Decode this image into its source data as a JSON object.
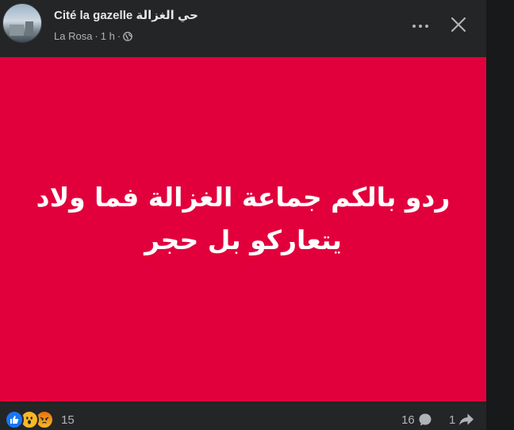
{
  "post": {
    "group_name": "Cité la gazelle حي الغزالة",
    "author": "La Rosa",
    "time": "1 h",
    "separator": "·",
    "privacy_icon": "globe-icon",
    "image_text_line1": "ردو بالكم جماعة الغزالة فما ولاد",
    "image_text_line2": "يتعاركو بل حجر"
  },
  "footer": {
    "reaction_count": "15",
    "comment_count": "16",
    "share_count": "1",
    "reaction_icons": [
      "like-icon",
      "wow-icon",
      "angry-icon"
    ]
  },
  "colors": {
    "image_background": "#e2003c",
    "card_background": "#242526",
    "page_background": "#18191a",
    "primary_text": "#e4e6eb",
    "secondary_text": "#b0b3b8"
  }
}
